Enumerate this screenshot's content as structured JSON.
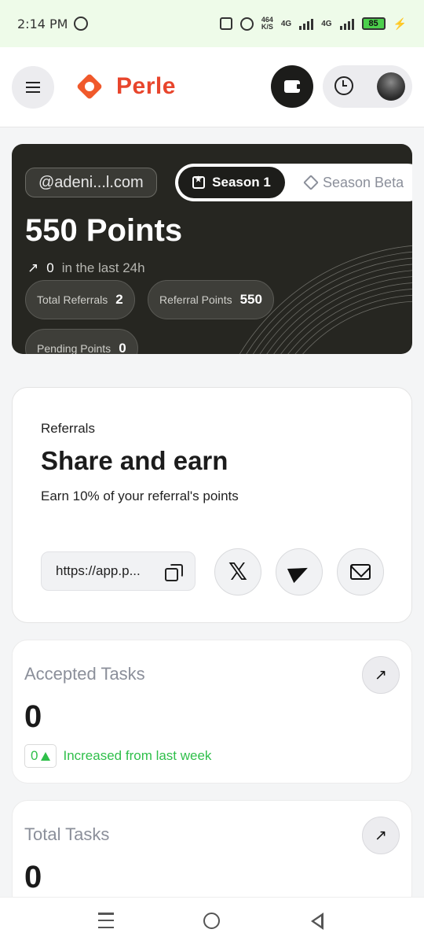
{
  "status_bar": {
    "time": "2:14 PM",
    "speed_value": "464",
    "speed_unit": "K/S",
    "network_1": "4G",
    "network_2": "4G",
    "battery": "85",
    "icons": [
      "whatsapp-icon",
      "vibrate-icon",
      "alarm-icon",
      "signal-icon",
      "battery-icon",
      "charging-icon"
    ]
  },
  "header": {
    "brand": "Perle",
    "icons": [
      "menu-icon",
      "perle-logo",
      "wallet-icon",
      "history-clock-icon",
      "avatar"
    ]
  },
  "points_card": {
    "email": "@adeni...l.com",
    "season_active": "Season 1",
    "season_inactive": "Season Beta",
    "points_title": "550 Points",
    "last24_value": "0",
    "last24_label": "in the last 24h",
    "chips": [
      {
        "label": "Total Referrals",
        "value": "2"
      },
      {
        "label": "Referral Points",
        "value": "550"
      },
      {
        "label": "Pending Points",
        "value": "0"
      }
    ]
  },
  "referrals": {
    "label": "Referrals",
    "title": "Share and earn",
    "subtitle": "Earn 10% of your referral's points",
    "link": "https://app.p...",
    "share_icons": [
      "x-icon",
      "telegram-icon",
      "mail-icon"
    ]
  },
  "tasks": [
    {
      "title": "Accepted Tasks",
      "value": "0",
      "trend_value": "0",
      "trend_label": "Increased from last week"
    },
    {
      "title": "Total Tasks",
      "value": "0"
    }
  ],
  "colors": {
    "brand": "#e8452c",
    "card_dark": "#262621",
    "trend_green": "#2fbf4a",
    "status_bar_bg": "#eefbe9"
  }
}
